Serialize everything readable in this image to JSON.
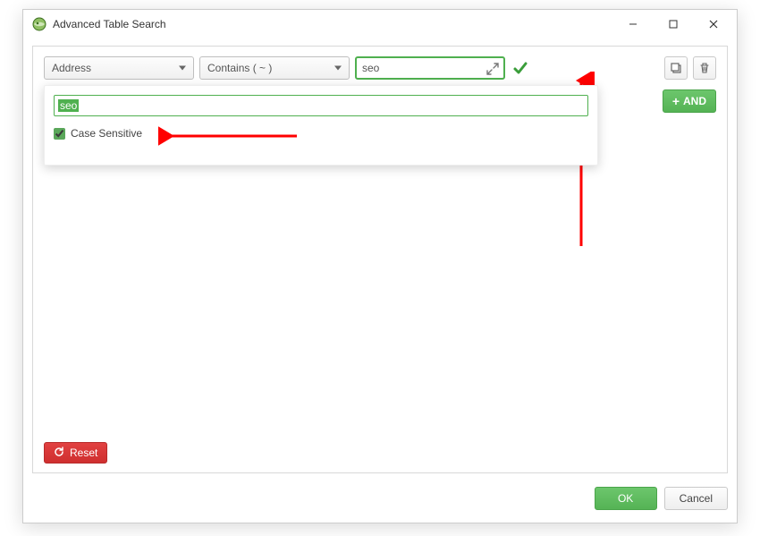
{
  "window": {
    "title": "Advanced Table Search"
  },
  "filter": {
    "field": "Address",
    "operator": "Contains ( ~ )",
    "value": "seo"
  },
  "popup": {
    "value": "seo",
    "case_label": "Case Sensitive",
    "case_checked": true
  },
  "buttons": {
    "and": "AND",
    "reset": "Reset",
    "ok": "OK",
    "cancel": "Cancel"
  },
  "colors": {
    "green": "#55b355",
    "red": "#cf2f2f",
    "annotation": "#ff0000"
  }
}
